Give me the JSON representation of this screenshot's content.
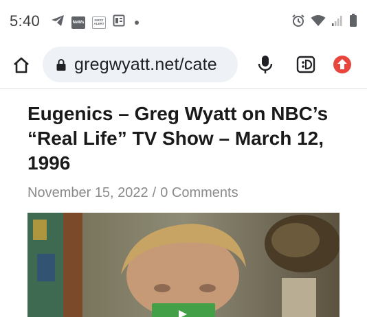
{
  "status_bar": {
    "time": "5:40",
    "left_icons": [
      "telegram-icon",
      "news-app-icon",
      "first-alert-icon",
      "reader-icon",
      "notification-dot-icon"
    ],
    "news_app_text": "NeWs",
    "first_alert_text": "FIRST ALERT",
    "right_icons": [
      "alarm-icon",
      "wifi-icon",
      "signal-icon",
      "battery-icon"
    ]
  },
  "browser": {
    "url": "gregwyatt.net/cate",
    "buttons": [
      "home-icon",
      "microphone-icon",
      "discord-icon",
      "upload-icon"
    ],
    "accent_red": "#e8453c"
  },
  "article": {
    "title": "Eugenics – Greg Wyatt on NBC’s “Real Life” TV Show – March 12, 1996",
    "date": "November 15, 2022",
    "separator": "/",
    "comments": "0 Comments"
  },
  "video": {
    "play_button_color": "#43a047"
  }
}
